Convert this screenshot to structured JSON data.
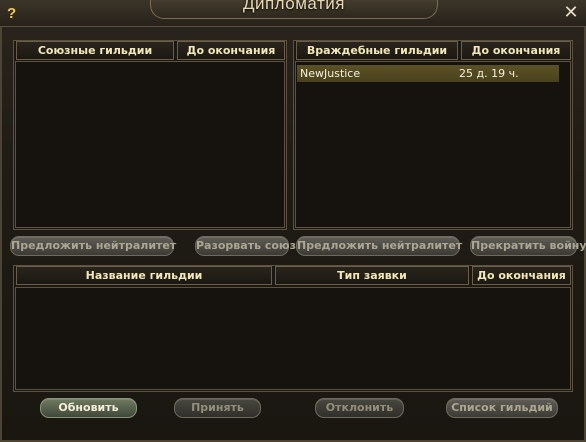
{
  "window": {
    "title": "Дипломатия",
    "help_icon": "question-mark-icon",
    "close_icon": "close-icon"
  },
  "allied": {
    "col_name": "Союзные гильдии",
    "col_time": "До окончания",
    "rows": []
  },
  "hostile": {
    "col_name": "Враждебные гильдии",
    "col_time": "До окончания",
    "rows": [
      {
        "name": "NewJustice",
        "time": "25 д. 19 ч."
      }
    ]
  },
  "buttons": {
    "allied_propose_neutral": "Предложить нейтралитет",
    "allied_break_alliance": "Разорвать союз",
    "hostile_propose_neutral": "Предложить нейтралитет",
    "hostile_stop_war": "Прекратить войну",
    "refresh": "Обновить",
    "accept": "Принять",
    "decline": "Отклонить",
    "guild_list": "Список гильдий"
  },
  "requests": {
    "col_guild": "Название гильдии",
    "col_type": "Тип заявки",
    "col_time": "До окончания",
    "rows": []
  },
  "colors": {
    "header_text": "#f1e7b8",
    "selected_row": "#5b5125",
    "active_button": "#6f7a5f"
  }
}
